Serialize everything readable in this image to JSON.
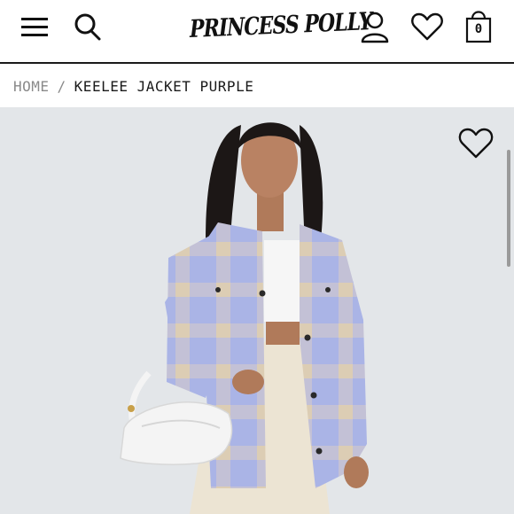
{
  "header": {
    "logo_text": "PRINCESS POLLY",
    "bag_count": "0",
    "icons": {
      "menu": "menu-icon",
      "search": "search-icon",
      "account": "user-icon",
      "wishlist": "heart-icon",
      "bag": "shopping-bag-icon"
    }
  },
  "breadcrumb": {
    "home": "HOME",
    "separator": "/",
    "current": "KEELEE JACKET PURPLE"
  },
  "product": {
    "wishlist_icon": "heart-icon",
    "colors": {
      "background": "#e3e6e9",
      "jacket_lavender": "#aab4e6",
      "jacket_beige": "#dccdb4",
      "bag_white": "#f4f4f4",
      "pants_cream": "#ece4d3"
    }
  }
}
